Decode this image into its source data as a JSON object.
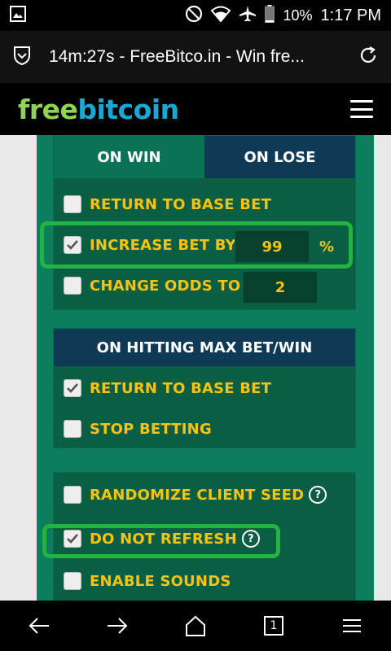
{
  "status_bar": {
    "battery": "10%",
    "time": "1:17 PM"
  },
  "browser": {
    "tab_title": "14m:27s - FreeBitco.in - Win fre..."
  },
  "site": {
    "logo_free": "free",
    "logo_bitcoin": "bitcoin"
  },
  "on_win_lose": {
    "tab_win": "ON WIN",
    "tab_lose": "ON LOSE",
    "options": [
      {
        "label": "RETURN TO BASE BET",
        "checked": false
      },
      {
        "label": "INCREASE BET BY",
        "checked": true,
        "value": "99",
        "suffix": "%"
      },
      {
        "label": "CHANGE ODDS TO",
        "checked": false,
        "value": "2"
      }
    ]
  },
  "max_bet": {
    "header": "ON HITTING MAX BET/WIN",
    "options": [
      {
        "label": "RETURN TO BASE BET",
        "checked": true
      },
      {
        "label": "STOP BETTING",
        "checked": false
      }
    ]
  },
  "settings": {
    "options": [
      {
        "label": "RANDOMIZE CLIENT SEED",
        "checked": false,
        "help": "?"
      },
      {
        "label": "DO NOT REFRESH",
        "checked": true,
        "help": "?"
      },
      {
        "label": "ENABLE SOUNDS",
        "checked": false
      }
    ]
  },
  "nav": {
    "tab_count": "1"
  },
  "colors": {
    "accent_yellow": "#f6c314",
    "highlight_green": "#22b53d",
    "panel_green": "#0a5e44",
    "header_navy": "#0f3a55"
  }
}
